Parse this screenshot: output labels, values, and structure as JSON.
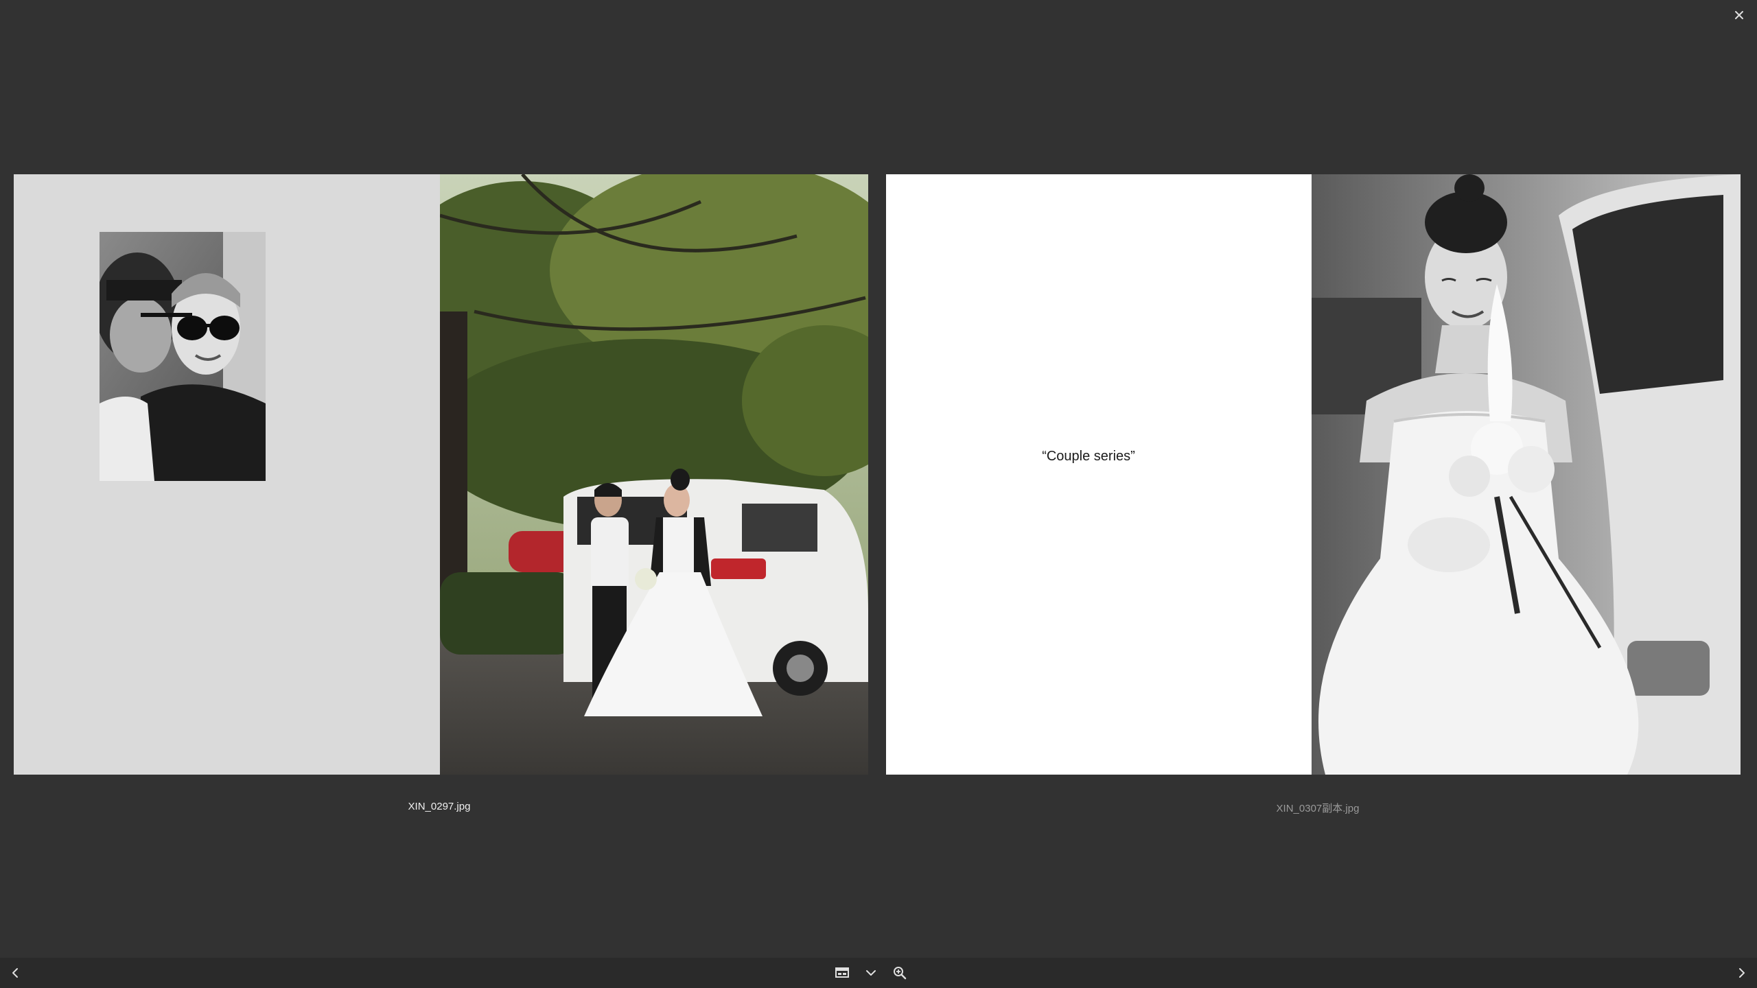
{
  "viewer": {
    "close_icon": "close-icon",
    "spreads": [
      {
        "caption": "XIN_0297.jpg",
        "left_page": {
          "kind": "gray-page-with-inset-photo"
        },
        "right_page": {
          "kind": "color-photo-couple-by-van"
        }
      },
      {
        "caption": "XIN_0307副本.jpg",
        "left_page": {
          "kind": "white-text-page",
          "quote": "“Couple series”"
        },
        "right_page": {
          "kind": "bw-photo-bride-bouquet"
        }
      }
    ]
  },
  "toolbar": {
    "prev_icon": "chevron-left-icon",
    "next_icon": "chevron-right-icon",
    "tools": [
      "gallery-icon",
      "chevron-down-icon",
      "zoom-in-icon"
    ]
  },
  "colors": {
    "background": "#323232",
    "bottom_bar": "#2a2a2a",
    "gray_page": "#dadada",
    "white_page": "#ffffff"
  }
}
